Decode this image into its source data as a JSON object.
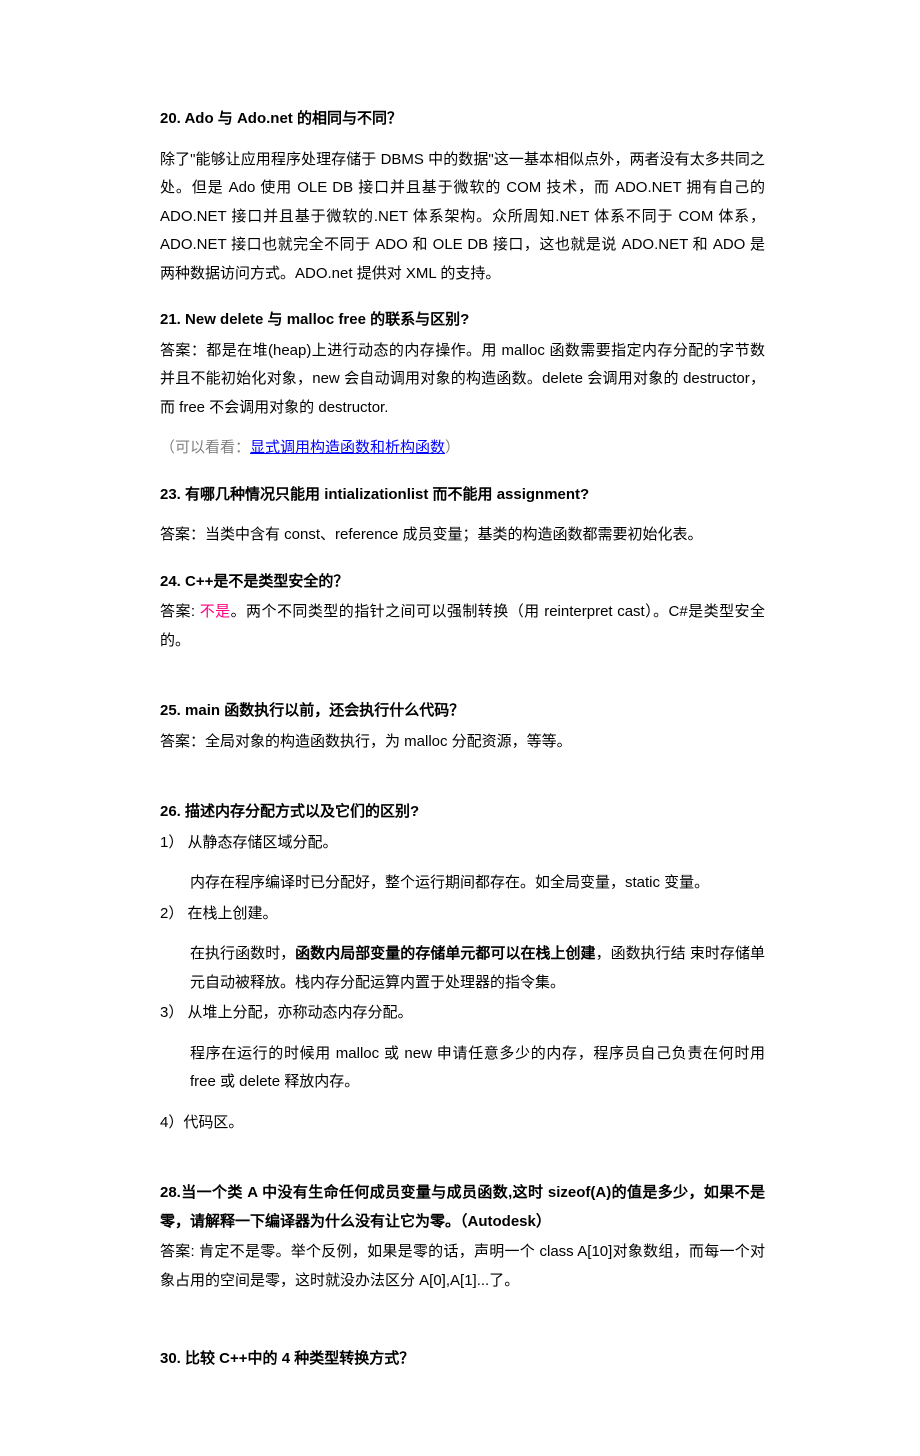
{
  "q20": {
    "title": " 20. Ado 与 Ado.net 的相同与不同？",
    "body": "除了\"能够让应用程序处理存储于 DBMS 中的数据\"这一基本相似点外，两者没有太多共同之处。但是 Ado 使用 OLE DB 接口并且基于微软的 COM 技术，而 ADO.NET 拥有自己的 ADO.NET 接口并且基于微软的.NET 体系架构。众所周知.NET 体系不同于 COM 体系，ADO.NET 接口也就完全不同于 ADO 和 OLE DB 接口，这也就是说 ADO.NET 和 ADO 是两种数据访问方式。ADO.net 提供对 XML 的支持。"
  },
  "q21": {
    "title": "21. New delete 与 malloc free 的联系与区别?",
    "body": "答案：都是在堆(heap)上进行动态的内存操作。用 malloc 函数需要指定内存分配的字节数并且不能初始化对象，new 会自动调用对象的构造函数。delete 会调用对象的 destructor，而 free 不会调用对象的 destructor.",
    "note_prefix": "（可以看看：",
    "note_link": "显式调用构造函数和析构函数",
    "note_suffix": "）"
  },
  "q23": {
    "title": "23. 有哪几种情况只能用 intializationlist 而不能用 assignment?",
    "body": "答案：当类中含有 const、reference 成员变量；基类的构造函数都需要初始化表。"
  },
  "q24": {
    "title": " 24. C++是不是类型安全的？",
    "body_prefix": "答案: ",
    "body_red": "不是",
    "body_suffix": "。两个不同类型的指针之间可以强制转换（用 reinterpret cast）。C#是类型安全的。"
  },
  "q25": {
    "title": "25. main 函数执行以前，还会执行什么代码？",
    "body": "答案：全局对象的构造函数执行，为 malloc 分配资源，等等。"
  },
  "q26": {
    "title": "26. 描述内存分配方式以及它们的区别?",
    "item1": "1） 从静态存储区域分配。",
    "item1_body": "内存在程序编译时已分配好，整个运行期间都存在。如全局变量，static 变量。",
    "item2": "2） 在栈上创建。",
    "item2_body_prefix": "在执行函数时，",
    "item2_body_bold": "函数内局部变量的存储单元都可以在栈上创建",
    "item2_body_suffix": "，函数执行结  束时存储单元自动被释放。栈内存分配运算内置于处理器的指令集。",
    "item3": "3） 从堆上分配，亦称动态内存分配。",
    "item3_body": "程序在运行的时候用 malloc 或 new 申请任意多少的内存，程序员自己负责在何时用 free 或 delete 释放内存。",
    "item4": "4）代码区。"
  },
  "q28": {
    "title": "28.当一个类 A 中没有生命任何成员变量与成员函数,这时 sizeof(A)的值是多少，如果不是零，请解释一下编译器为什么没有让它为零。（Autodesk）",
    "body": "答案: 肯定不是零。举个反例，如果是零的话，声明一个 class A[10]对象数组，而每一个对象占用的空间是零，这时就没办法区分 A[0],A[1]...了。"
  },
  "q30": {
    "title": "30. 比较 C++中的 4 种类型转换方式？"
  }
}
